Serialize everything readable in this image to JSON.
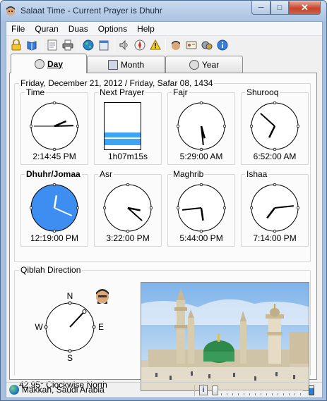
{
  "window": {
    "title": "Salaat Time - Current Prayer is Dhuhr"
  },
  "window_controls": {
    "minimize": "─",
    "maximize": "□",
    "close": "✕"
  },
  "menu": [
    "File",
    "Quran",
    "Duas",
    "Options",
    "Help"
  ],
  "toolbar_icons": [
    "lock-icon",
    "book-icon",
    "notes-icon",
    "printer-icon",
    "globe-icon",
    "calendar-icon",
    "speaker-icon",
    "compass-icon",
    "warning-icon",
    "person-icon",
    "card-icon",
    "tools-icon",
    "info-icon"
  ],
  "tabs": [
    {
      "label": "Day",
      "active": true
    },
    {
      "label": "Month",
      "active": false
    },
    {
      "label": "Year",
      "active": false
    }
  ],
  "date_line": "Friday, December 21, 2012 / Friday, Safar 08, 1434",
  "cells": {
    "time": {
      "label": "Time",
      "value": "2:14:45 PM"
    },
    "next_prayer": {
      "label": "Next Prayer",
      "value": "1h07m15s",
      "progress_remaining": 0.27
    },
    "fajr": {
      "label": "Fajr",
      "value": "5:29:00 AM"
    },
    "shurooq": {
      "label": "Shurooq",
      "value": "6:52:00 AM"
    },
    "dhuhr": {
      "label": "Dhuhr/Jomaa",
      "value": "12:19:00 PM",
      "current": true
    },
    "asr": {
      "label": "Asr",
      "value": "3:22:00 PM"
    },
    "maghrib": {
      "label": "Maghrib",
      "value": "5:44:00 PM"
    },
    "ishaa": {
      "label": "Ishaa",
      "value": "7:14:00 PM"
    }
  },
  "qiblah": {
    "label": "Qiblah Direction",
    "n": "N",
    "e": "E",
    "s": "S",
    "w": "W",
    "bearing_degrees": 42.95,
    "text": "42.95° Clockwise North"
  },
  "status": {
    "location": "Makkah, Saudi Arabia",
    "info_glyph": "i",
    "slider_value": 0
  },
  "colors": {
    "active_clock": "#3d8ef0",
    "progress_fill": "#3da5f4",
    "title_bar": "#b9cfe9"
  }
}
